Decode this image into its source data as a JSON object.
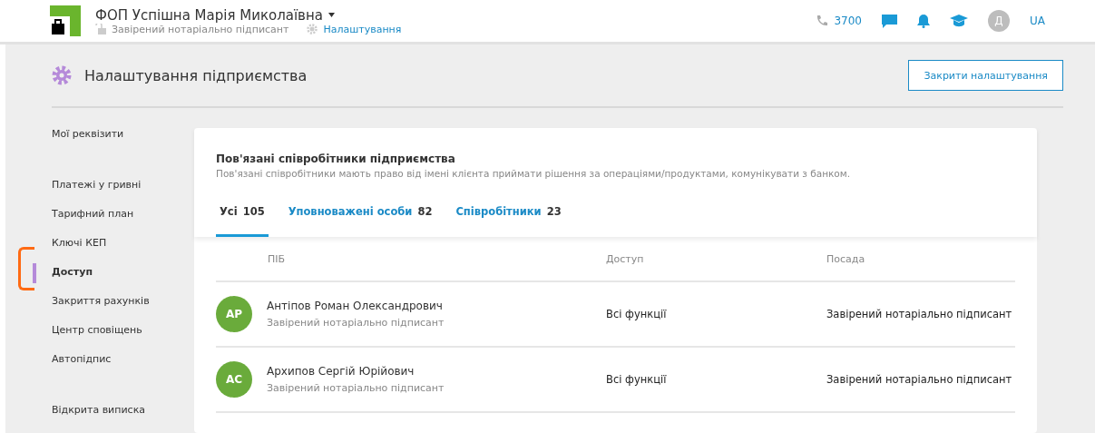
{
  "header": {
    "company": "ФОП Успішна Марія Миколаївна",
    "role": "Завірений нотаріально підписант",
    "settings_link": "Налаштування",
    "phone": "3700",
    "avatar": "Д",
    "language": "UA"
  },
  "page": {
    "title": "Налаштування підприємства",
    "close_button": "Закрити налаштування"
  },
  "sidebar": {
    "groups": [
      [
        {
          "label": "Мої реквізити",
          "selected": false
        }
      ],
      [
        {
          "label": "Платежі у гривні",
          "selected": false
        },
        {
          "label": "Тарифний план",
          "selected": false
        },
        {
          "label": "Ключі КЕП",
          "selected": false
        },
        {
          "label": "Доступ",
          "selected": true
        },
        {
          "label": "Закриття рахунків",
          "selected": false
        },
        {
          "label": "Центр сповіщень",
          "selected": false
        },
        {
          "label": "Автопідпис",
          "selected": false
        }
      ],
      [
        {
          "label": "Відкрита виписка",
          "selected": false
        }
      ]
    ]
  },
  "card": {
    "title": "Пов'язані співробітники підприємства",
    "description": "Пов'язані співробітники мають право від імені клієнта приймати рішення за операціями/продуктами, комунікувати з банком.",
    "tabs": [
      {
        "label": "Усі",
        "count": "105",
        "selected": true
      },
      {
        "label": "Уповноважені особи",
        "count": "82",
        "selected": false
      },
      {
        "label": "Співробітники",
        "count": "23",
        "selected": false
      }
    ]
  },
  "table": {
    "columns": [
      "ПІБ",
      "Доступ",
      "Посада"
    ],
    "rows": [
      {
        "initials": "АР",
        "color": "#6aab3b",
        "name": "Антіпов Роман Олександрович",
        "role": "Завірений нотаріально підписант",
        "access": "Всі функції",
        "position": "Завірений нотаріально підписант"
      },
      {
        "initials": "АС",
        "color": "#6aab3b",
        "name": "Архипов Сергій Юрійович",
        "role": "Завірений нотаріально підписант",
        "access": "Всі функції",
        "position": "Завірений нотаріально підписант"
      }
    ]
  }
}
